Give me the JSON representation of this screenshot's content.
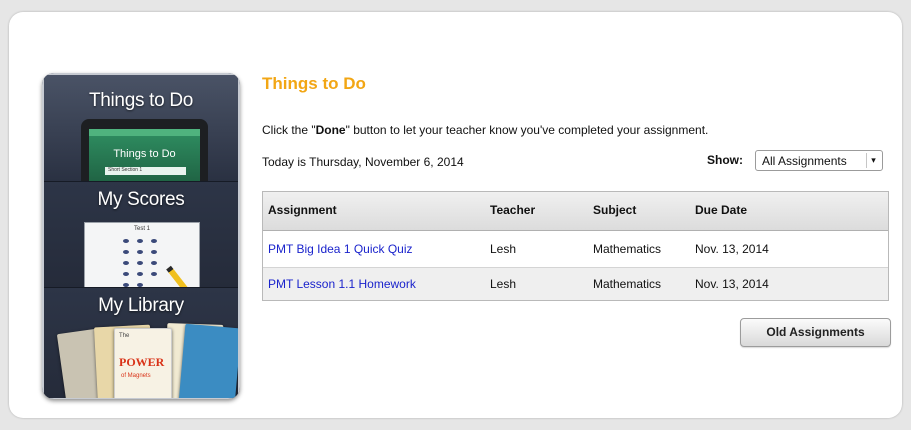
{
  "sidebar": {
    "items": [
      {
        "label": "Things to Do",
        "screen_title": "Things to Do",
        "screen_row": "Short Section 1"
      },
      {
        "label": "My Scores",
        "sheet_title": "Test 1"
      },
      {
        "label": "My Library",
        "book_title": "The",
        "book_power": "POWER",
        "book_sub": "of Magnets"
      }
    ]
  },
  "main": {
    "title": "Things to Do",
    "instructions": {
      "prefix": "Click the \"",
      "bold": "Done",
      "suffix": "\" button to let your teacher know you've completed your assignment."
    },
    "today": "Today is Thursday, November 6, 2014",
    "show_label": "Show:",
    "show_value": "All Assignments",
    "table": {
      "headers": [
        "Assignment",
        "Teacher",
        "Subject",
        "Due Date"
      ],
      "rows": [
        [
          "PMT Big Idea 1 Quick Quiz",
          "Lesh",
          "Mathematics",
          "Nov. 13, 2014"
        ],
        [
          "PMT Lesson 1.1 Homework",
          "Lesh",
          "Mathematics",
          "Nov. 13, 2014"
        ]
      ]
    },
    "old_assignments_label": "Old Assignments"
  },
  "colors": {
    "title_accent": "#f2a614",
    "link": "#1a23cc",
    "sidebar_bg": "#2f3748"
  }
}
